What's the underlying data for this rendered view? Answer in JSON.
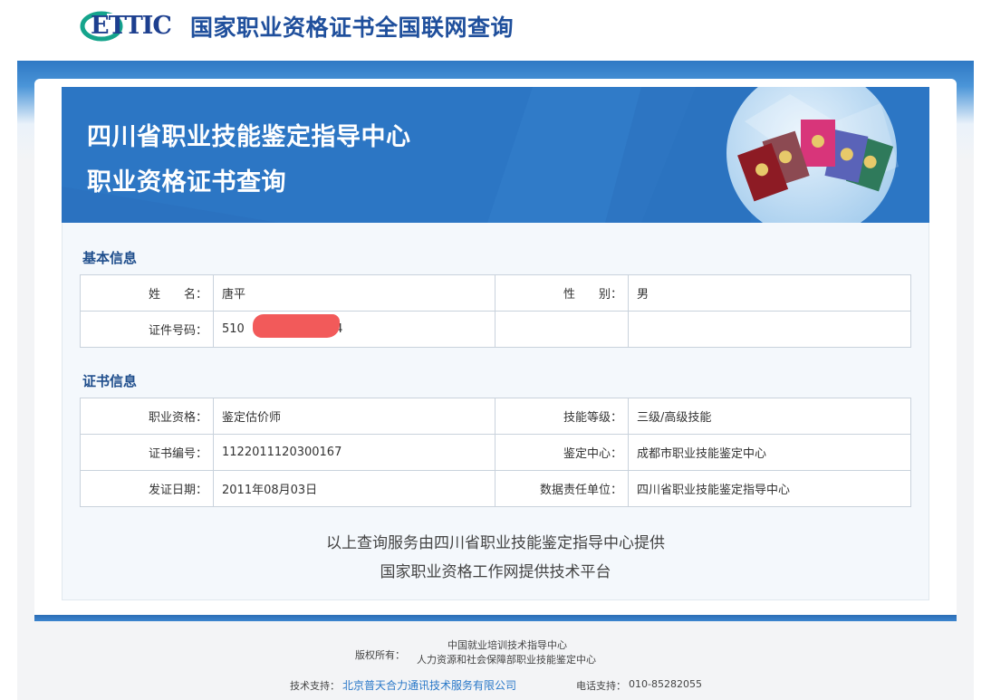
{
  "header": {
    "logo_text": "ETTIC",
    "site_title": "国家职业资格证书全国联网查询"
  },
  "banner": {
    "line1": "四川省职业技能鉴定指导中心",
    "line2": "职业资格证书查询"
  },
  "basic_info": {
    "section_title": "基本信息",
    "name_label": "姓　　名：",
    "name_value": "唐平",
    "gender_label": "性　　别：",
    "gender_value": "男",
    "id_label": "证件号码：",
    "id_prefix": "510",
    "id_suffix": "14"
  },
  "cert_info": {
    "section_title": "证书信息",
    "qualification_label": "职业资格：",
    "qualification_value": "鉴定估价师",
    "level_label": "技能等级：",
    "level_value": "三级/高级技能",
    "cert_no_label": "证书编号：",
    "cert_no_value": "1122011120300167",
    "center_label": "鉴定中心：",
    "center_value": "成都市职业技能鉴定中心",
    "issue_date_label": "发证日期：",
    "issue_date_value": "2011年08月03日",
    "responsible_label": "数据责任单位：",
    "responsible_value": "四川省职业技能鉴定指导中心"
  },
  "notes": {
    "line1": "以上查询服务由四川省职业技能鉴定指导中心提供",
    "line2": "国家职业资格工作网提供技术平台"
  },
  "footer": {
    "copyright_label": "版权所有：",
    "copyright_org1": "中国就业培训技术指导中心",
    "copyright_org2": "人力资源和社会保障部职业技能鉴定中心",
    "support_label": "技术支持：",
    "support_company": "北京普天合力通讯技术服务有限公司",
    "phone_label": "电话支持：",
    "phone_value": "010-85282055"
  },
  "colors": {
    "brand_blue": "#2c76c4",
    "title_blue": "#1f4f9c",
    "redaction": "#f25a5a"
  }
}
